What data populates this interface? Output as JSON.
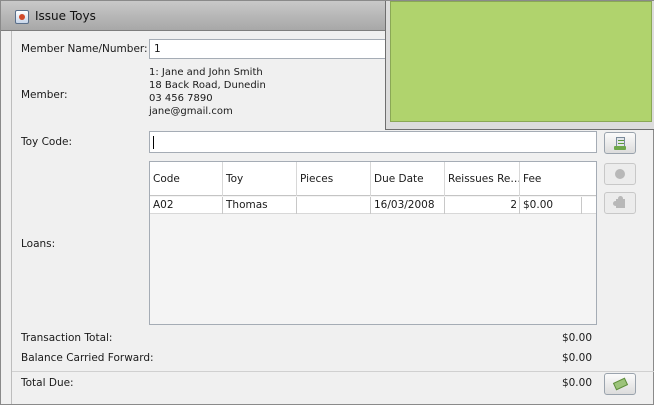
{
  "window": {
    "title": "Issue Toys"
  },
  "member": {
    "name_label": "Member Name/Number:",
    "name_value": "1",
    "info_label": "Member:",
    "info_lines": [
      "1: Jane and John Smith",
      "18 Back Road, Dunedin",
      "03 456 7890",
      "jane@gmail.com"
    ]
  },
  "toy_code": {
    "label": "Toy Code:",
    "value": ""
  },
  "loans": {
    "label": "Loans:",
    "columns": [
      "Code",
      "Toy",
      "Pieces",
      "Due Date",
      "Reissues Re…",
      "Fee"
    ],
    "rows": [
      {
        "code": "A02",
        "toy": "Thomas",
        "pieces": "",
        "due_date": "16/03/2008",
        "reissues": "2",
        "fee": "$0.00"
      }
    ]
  },
  "totals": {
    "transaction_label": "Transaction Total:",
    "transaction_value": "$0.00",
    "balance_label": "Balance Carried Forward:",
    "balance_value": "$0.00",
    "due_label": "Total Due:",
    "due_value": "$0.00"
  },
  "icons": {
    "add_toy": "add-toy-icon",
    "remove_loan": "remove-loan-icon",
    "reissue": "puzzle-icon",
    "pay": "money-icon",
    "app": "java-app-icon"
  },
  "colors": {
    "overlay_green": "#b0d36d"
  }
}
